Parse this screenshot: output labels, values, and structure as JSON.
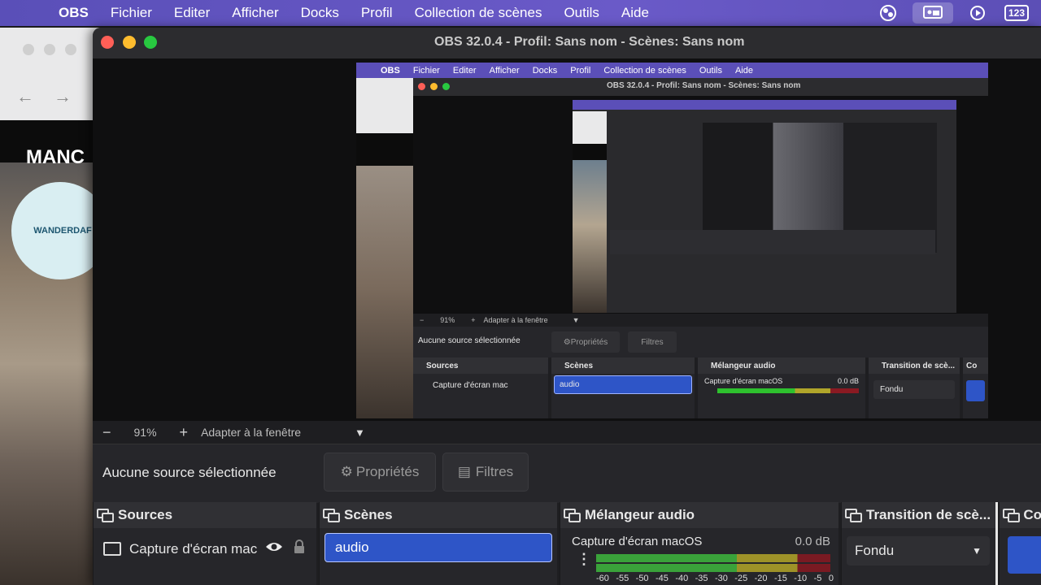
{
  "menubar": {
    "app": "OBS",
    "items": [
      "Fichier",
      "Editer",
      "Afficher",
      "Docks",
      "Profil",
      "Collection de scènes",
      "Outils",
      "Aide"
    ],
    "kbd_indicator": "123"
  },
  "browser": {
    "brand": "MANC",
    "logo_text": "WANDERDAF"
  },
  "obs": {
    "title": "OBS 32.0.4 - Profil: Sans nom - Scènes: Sans nom",
    "toolbar": {
      "zoom_out": "−",
      "zoom": "91%",
      "zoom_in": "+",
      "fit": "Adapter à la fenêtre"
    },
    "properties": {
      "no_source": "Aucune source sélectionnée",
      "props_button": "Propriétés",
      "filters_button": "Filtres"
    },
    "docks": {
      "sources": {
        "title": "Sources",
        "items": [
          "Capture d'écran mac"
        ]
      },
      "scenes": {
        "title": "Scènes",
        "items": [
          "audio"
        ]
      },
      "mixer": {
        "title": "Mélangeur audio",
        "track": "Capture d'écran macOS",
        "db": "0.0 dB",
        "ticks": [
          "-60",
          "-55",
          "-50",
          "-45",
          "-40",
          "-35",
          "-30",
          "-25",
          "-20",
          "-15",
          "-10",
          "-5",
          "0"
        ]
      },
      "transitions": {
        "title": "Transition de scè...",
        "selected": "Fondu"
      },
      "controls": {
        "title": "Co"
      }
    }
  },
  "nested": {
    "title": "OBS 32.0.4 - Profil: Sans nom - Scènes: Sans nom",
    "zoom": "91%",
    "fit": "Adapter à la fenêtre",
    "no_source": "Aucune source sélectionnée",
    "props_button": "Propriétés",
    "filters_button": "Filtres",
    "sources_title": "Sources",
    "source_item": "Capture d'écran mac",
    "scenes_title": "Scènes",
    "scene_item": "audio",
    "mixer_title": "Mélangeur audio",
    "mixer_track": "Capture d'écran macOS",
    "mixer_db": "0.0 dB",
    "transitions_title": "Transition de scè...",
    "transition_selected": "Fondu",
    "controls_title": "Co"
  },
  "colors": {
    "menubar": "#5b4fb8",
    "selection": "#2e55c7",
    "meter_green": "#2ec12e",
    "meter_yellow": "#b0a52a",
    "meter_red": "#8a1a22"
  }
}
